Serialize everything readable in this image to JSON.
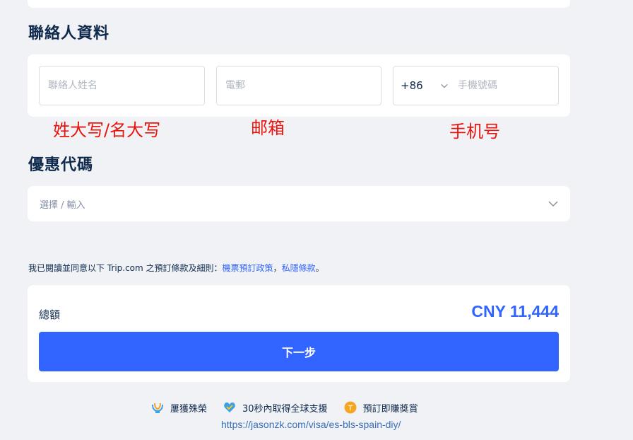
{
  "contact": {
    "title": "聯絡人資料",
    "name_placeholder": "聯絡人姓名",
    "email_placeholder": "電郵",
    "phone_code": "+86",
    "phone_placeholder": "手機號碼"
  },
  "annotations": {
    "name": "姓大写/名大写",
    "email": "邮箱",
    "phone": "手机号"
  },
  "promo": {
    "title": "優惠代碼",
    "placeholder": "選擇 / 輸入"
  },
  "terms": {
    "prefix": "我已閱讀並同意以下 Trip.com 之預訂條款及細則：",
    "link1": "機票預訂政策",
    "separator": "，",
    "link2": "私隱條款",
    "suffix": "。"
  },
  "summary": {
    "total_label": "總額",
    "total_value": "CNY 11,444",
    "next_label": "下一步"
  },
  "badges": [
    {
      "label": "屢獲殊榮",
      "icon": "award-icon"
    },
    {
      "label": "30秒內取得全球支援",
      "icon": "heart-check-icon"
    },
    {
      "label": "預訂即賺獎賞",
      "icon": "coin-icon"
    }
  ],
  "footer": {
    "url": "https://jasonzk.com/visa/es-bls-spain-diy/"
  },
  "colors": {
    "primary": "#3264ff",
    "annotation": "#e8150f",
    "text": "#0f294d"
  }
}
